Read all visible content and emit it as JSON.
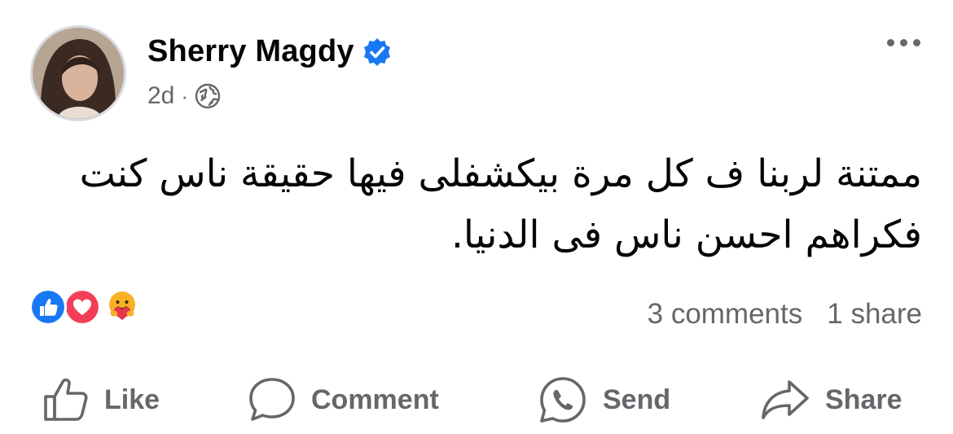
{
  "post": {
    "author": "Sherry Magdy",
    "timestamp": "2d",
    "separator": "·",
    "verified_icon": "verified-badge-icon",
    "privacy_icon": "globe-icon",
    "text": "ممتنة لربنا ف كل مرة بيكشفلى فيها حقيقة ناس كنت فكراهم احسن ناس فى الدنيا.",
    "reactions": [
      "like",
      "love",
      "care"
    ],
    "comments_label": "3 comments",
    "shares_label": "1 share"
  },
  "actions": {
    "like": "Like",
    "comment": "Comment",
    "send": "Send",
    "share": "Share"
  },
  "colors": {
    "accent": "#1877f2",
    "love": "#f33e58",
    "care": "#f7b125",
    "secondary_text": "#65676b"
  }
}
